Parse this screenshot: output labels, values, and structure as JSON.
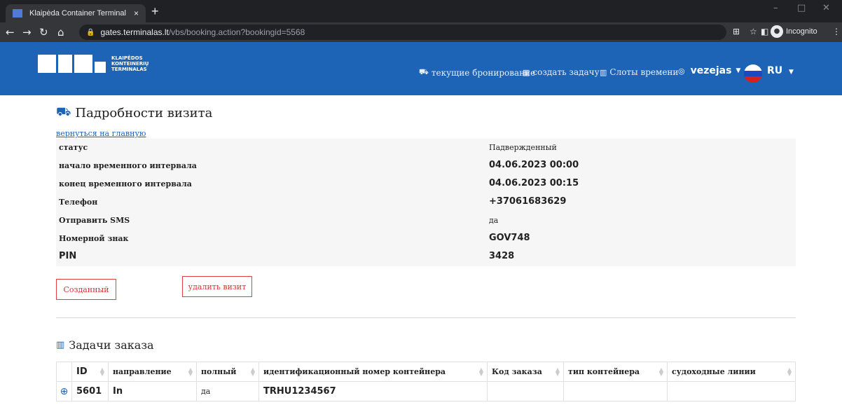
{
  "browser": {
    "tab_title": "Klaipėda Container Terminal",
    "tab_close": "×",
    "new_tab": "+",
    "url_host": "gates.terminalas.lt",
    "url_path": "/vbs/booking.action?bookingid=5568",
    "incognito_label": "Incognito"
  },
  "header": {
    "logo_lines": [
      "KLAIPĖDOS",
      "KONTEINERIŲ",
      "TERMINALAS"
    ],
    "nav": [
      {
        "icon": "truck-icon",
        "label": "текущие бронирование"
      },
      {
        "icon": "calendar-icon",
        "label": "создать задачу"
      },
      {
        "icon": "clock-icon",
        "label": "Слоты времени"
      }
    ],
    "user": "vezejas",
    "language": "RU"
  },
  "page": {
    "title": "Падробности визита",
    "back_link": "вернуться на главную",
    "details": [
      {
        "key": "статус",
        "value": "Падвержденный"
      },
      {
        "key": "начало временного интервала",
        "value": "04.06.2023 00:00"
      },
      {
        "key": "конец временного интервала",
        "value": "04.06.2023 00:15"
      },
      {
        "key": "Телефон",
        "value": "+37061683629"
      },
      {
        "key": "Отправить SMS",
        "value": "да"
      },
      {
        "key": "Номерной знак",
        "value": "GOV748"
      },
      {
        "key": "PIN",
        "value": "3428"
      }
    ],
    "status_button": "Созданный",
    "delete_button": "удалить визит",
    "tasks_title": "Задачи заказа",
    "table": {
      "headers": [
        "",
        "ID",
        "направление",
        "полный",
        "идентификационный номер контейнера",
        "Код заказа",
        "тип контейнера",
        "судоходные линии"
      ],
      "rows": [
        {
          "id": "5601",
          "direction": "In",
          "full": "да",
          "container": "TRHU1234567",
          "order_code": "",
          "container_type": "",
          "shipping_line": ""
        }
      ]
    }
  },
  "colors": {
    "header_bg": "#1d64b7",
    "accent_red": "#e04040"
  }
}
